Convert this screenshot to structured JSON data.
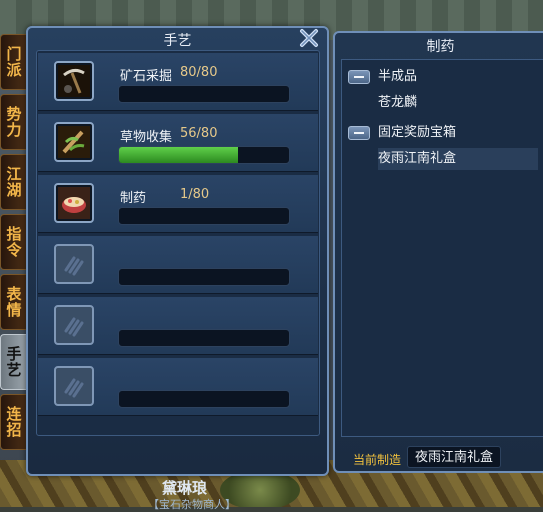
{
  "tabs": [
    {
      "label": "门派",
      "active": false
    },
    {
      "label": "势力",
      "active": false
    },
    {
      "label": "江湖",
      "active": false
    },
    {
      "label": "指令",
      "active": false
    },
    {
      "label": "表情",
      "active": false
    },
    {
      "label": "手艺",
      "active": true
    },
    {
      "label": "连招",
      "active": false
    }
  ],
  "craft_panel": {
    "title": "手艺",
    "skills": [
      {
        "name": "矿石采掘",
        "value": "80/80",
        "progress": 0,
        "icon": "pickaxe-icon"
      },
      {
        "name": "草物收集",
        "value": "56/80",
        "progress": 0.7,
        "icon": "herb-icon"
      },
      {
        "name": "制药",
        "value": "1/80",
        "progress": 0,
        "icon": "medicine-icon"
      },
      {
        "name": "",
        "value": "",
        "progress": 0,
        "icon": "empty-hand-icon"
      },
      {
        "name": "",
        "value": "",
        "progress": 0,
        "icon": "empty-hand-icon"
      },
      {
        "name": "",
        "value": "",
        "progress": 0,
        "icon": "empty-hand-icon"
      }
    ]
  },
  "medicine_panel": {
    "title": "制药",
    "tree": [
      {
        "label": "半成品",
        "type": "group"
      },
      {
        "label": "苍龙麟",
        "type": "item"
      },
      {
        "label": "固定奖励宝箱",
        "type": "group"
      },
      {
        "label": "夜雨江南礼盒",
        "type": "item",
        "selected": true
      }
    ],
    "current_label": "当前制造",
    "current_value": "夜雨江南礼盒"
  },
  "npc": {
    "name": "黛琳琅",
    "subtitle": "【宝石杂物商人】"
  },
  "colors": {
    "accent_gold": "#f2c23e",
    "progress_green": "#5fd04a",
    "panel_border": "#6f8fb8"
  }
}
